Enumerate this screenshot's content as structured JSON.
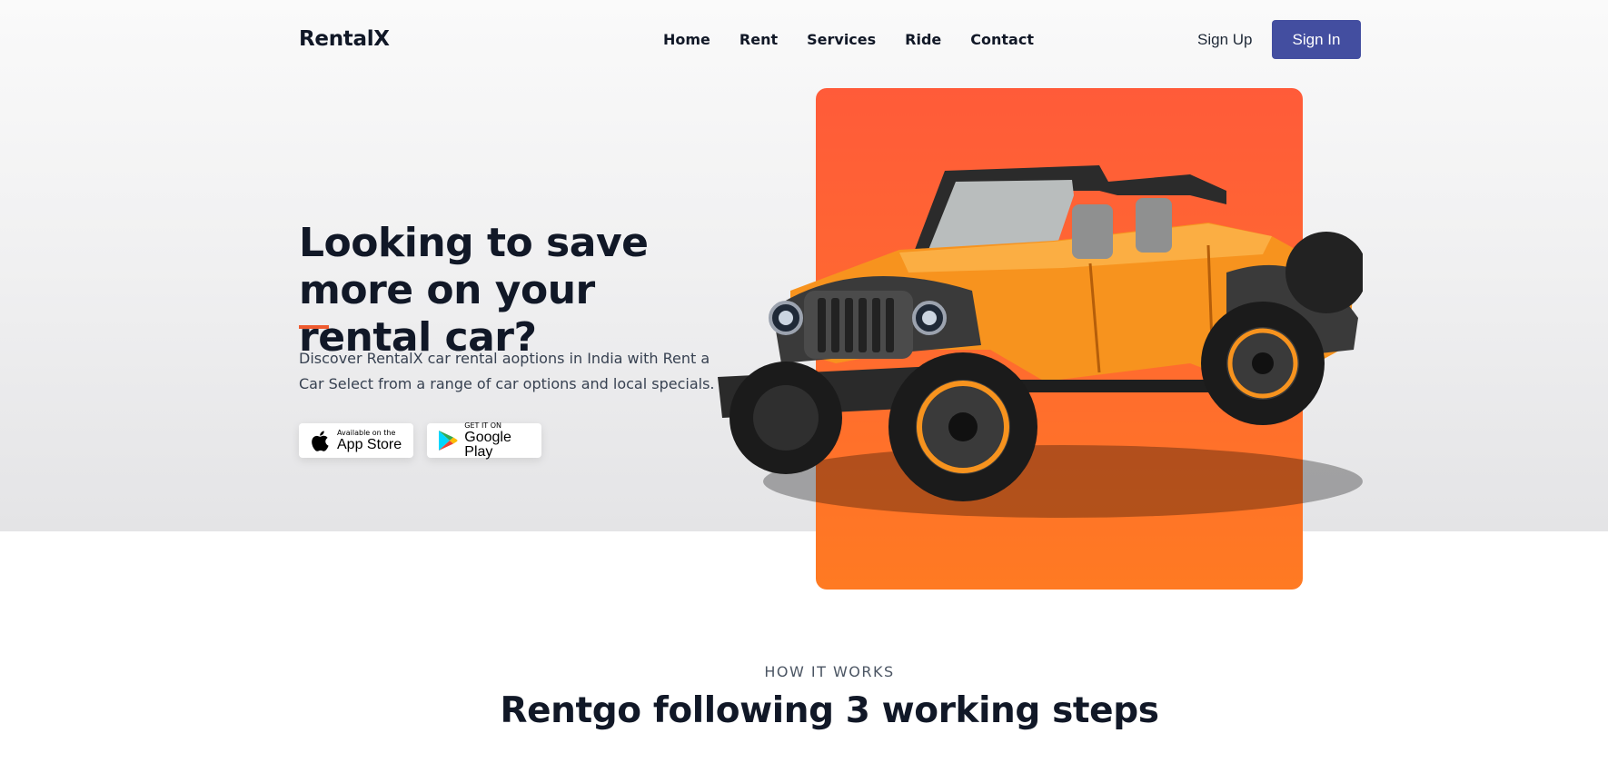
{
  "header": {
    "logo": "RentalX",
    "nav": [
      "Home",
      "Rent",
      "Services",
      "Ride",
      "Contact"
    ],
    "sign_up": "Sign Up",
    "sign_in": "Sign In"
  },
  "hero": {
    "title": "Looking to save more on your rental car?",
    "description": "Discover RentalX car rental aoptions in India with Rent a Car Select from a range of car options and local specials.",
    "app_store": {
      "small": "Available on the",
      "big": "App Store"
    },
    "google_play": {
      "small": "GET IT ON",
      "big": "Google Play"
    }
  },
  "how_it_works": {
    "label": "HOW IT WORKS",
    "title": "Rentgo following 3 working steps"
  },
  "colors": {
    "brand_button": "#434ea0",
    "accent": "#ef5b2f",
    "panel_top": "#ff5b39",
    "panel_bottom": "#ff7a22",
    "jeep_body": "#f7931e"
  },
  "icons": [
    "apple-icon",
    "google-play-icon",
    "jeep-image"
  ]
}
